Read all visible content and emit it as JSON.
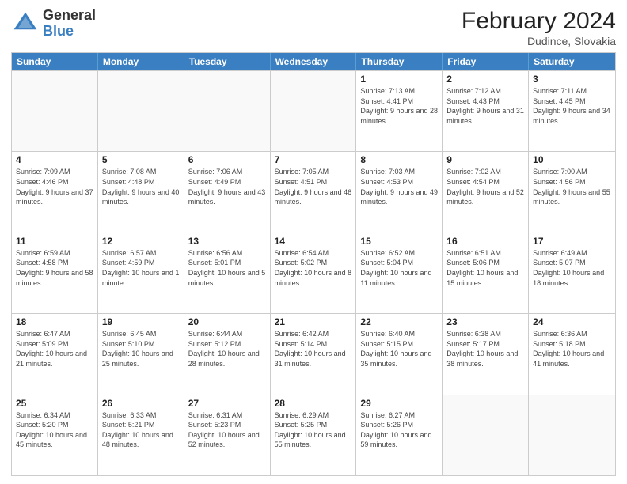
{
  "header": {
    "logo_general": "General",
    "logo_blue": "Blue",
    "title": "February 2024",
    "location": "Dudince, Slovakia"
  },
  "days_of_week": [
    "Sunday",
    "Monday",
    "Tuesday",
    "Wednesday",
    "Thursday",
    "Friday",
    "Saturday"
  ],
  "weeks": [
    [
      {
        "num": "",
        "info": "",
        "empty": true
      },
      {
        "num": "",
        "info": "",
        "empty": true
      },
      {
        "num": "",
        "info": "",
        "empty": true
      },
      {
        "num": "",
        "info": "",
        "empty": true
      },
      {
        "num": "1",
        "info": "Sunrise: 7:13 AM\nSunset: 4:41 PM\nDaylight: 9 hours and 28 minutes."
      },
      {
        "num": "2",
        "info": "Sunrise: 7:12 AM\nSunset: 4:43 PM\nDaylight: 9 hours and 31 minutes."
      },
      {
        "num": "3",
        "info": "Sunrise: 7:11 AM\nSunset: 4:45 PM\nDaylight: 9 hours and 34 minutes."
      }
    ],
    [
      {
        "num": "4",
        "info": "Sunrise: 7:09 AM\nSunset: 4:46 PM\nDaylight: 9 hours and 37 minutes."
      },
      {
        "num": "5",
        "info": "Sunrise: 7:08 AM\nSunset: 4:48 PM\nDaylight: 9 hours and 40 minutes."
      },
      {
        "num": "6",
        "info": "Sunrise: 7:06 AM\nSunset: 4:49 PM\nDaylight: 9 hours and 43 minutes."
      },
      {
        "num": "7",
        "info": "Sunrise: 7:05 AM\nSunset: 4:51 PM\nDaylight: 9 hours and 46 minutes."
      },
      {
        "num": "8",
        "info": "Sunrise: 7:03 AM\nSunset: 4:53 PM\nDaylight: 9 hours and 49 minutes."
      },
      {
        "num": "9",
        "info": "Sunrise: 7:02 AM\nSunset: 4:54 PM\nDaylight: 9 hours and 52 minutes."
      },
      {
        "num": "10",
        "info": "Sunrise: 7:00 AM\nSunset: 4:56 PM\nDaylight: 9 hours and 55 minutes."
      }
    ],
    [
      {
        "num": "11",
        "info": "Sunrise: 6:59 AM\nSunset: 4:58 PM\nDaylight: 9 hours and 58 minutes."
      },
      {
        "num": "12",
        "info": "Sunrise: 6:57 AM\nSunset: 4:59 PM\nDaylight: 10 hours and 1 minute."
      },
      {
        "num": "13",
        "info": "Sunrise: 6:56 AM\nSunset: 5:01 PM\nDaylight: 10 hours and 5 minutes."
      },
      {
        "num": "14",
        "info": "Sunrise: 6:54 AM\nSunset: 5:02 PM\nDaylight: 10 hours and 8 minutes."
      },
      {
        "num": "15",
        "info": "Sunrise: 6:52 AM\nSunset: 5:04 PM\nDaylight: 10 hours and 11 minutes."
      },
      {
        "num": "16",
        "info": "Sunrise: 6:51 AM\nSunset: 5:06 PM\nDaylight: 10 hours and 15 minutes."
      },
      {
        "num": "17",
        "info": "Sunrise: 6:49 AM\nSunset: 5:07 PM\nDaylight: 10 hours and 18 minutes."
      }
    ],
    [
      {
        "num": "18",
        "info": "Sunrise: 6:47 AM\nSunset: 5:09 PM\nDaylight: 10 hours and 21 minutes."
      },
      {
        "num": "19",
        "info": "Sunrise: 6:45 AM\nSunset: 5:10 PM\nDaylight: 10 hours and 25 minutes."
      },
      {
        "num": "20",
        "info": "Sunrise: 6:44 AM\nSunset: 5:12 PM\nDaylight: 10 hours and 28 minutes."
      },
      {
        "num": "21",
        "info": "Sunrise: 6:42 AM\nSunset: 5:14 PM\nDaylight: 10 hours and 31 minutes."
      },
      {
        "num": "22",
        "info": "Sunrise: 6:40 AM\nSunset: 5:15 PM\nDaylight: 10 hours and 35 minutes."
      },
      {
        "num": "23",
        "info": "Sunrise: 6:38 AM\nSunset: 5:17 PM\nDaylight: 10 hours and 38 minutes."
      },
      {
        "num": "24",
        "info": "Sunrise: 6:36 AM\nSunset: 5:18 PM\nDaylight: 10 hours and 41 minutes."
      }
    ],
    [
      {
        "num": "25",
        "info": "Sunrise: 6:34 AM\nSunset: 5:20 PM\nDaylight: 10 hours and 45 minutes."
      },
      {
        "num": "26",
        "info": "Sunrise: 6:33 AM\nSunset: 5:21 PM\nDaylight: 10 hours and 48 minutes."
      },
      {
        "num": "27",
        "info": "Sunrise: 6:31 AM\nSunset: 5:23 PM\nDaylight: 10 hours and 52 minutes."
      },
      {
        "num": "28",
        "info": "Sunrise: 6:29 AM\nSunset: 5:25 PM\nDaylight: 10 hours and 55 minutes."
      },
      {
        "num": "29",
        "info": "Sunrise: 6:27 AM\nSunset: 5:26 PM\nDaylight: 10 hours and 59 minutes."
      },
      {
        "num": "",
        "info": "",
        "empty": true
      },
      {
        "num": "",
        "info": "",
        "empty": true
      }
    ]
  ]
}
